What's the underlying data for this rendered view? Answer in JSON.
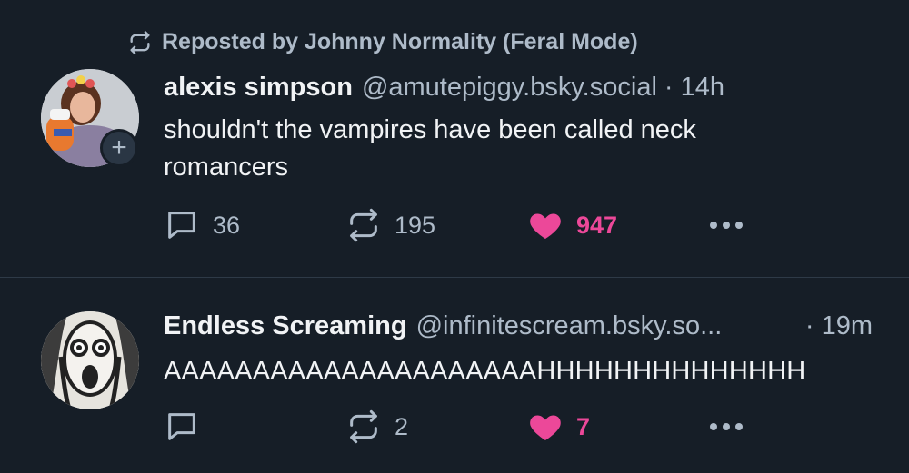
{
  "posts": [
    {
      "repost_label": "Reposted by Johnny Normality (Feral Mode)",
      "author": {
        "display_name": "alexis simpson",
        "handle": "@amutepiggy.bsky.social"
      },
      "separator": "·",
      "time": "14h",
      "text": "shouldn't the vampires have been called neck romancers",
      "stats": {
        "replies": "36",
        "reposts": "195",
        "likes": "947"
      },
      "liked": true
    },
    {
      "author": {
        "display_name": "Endless Screaming",
        "handle": "@infinitescream.bsky.so..."
      },
      "separator": "·",
      "time": "19m",
      "text": "AAAAAAAAAAAAAAAAAAAAAHHHHHHHHHHHHHH",
      "stats": {
        "replies": "",
        "reposts": "2",
        "likes": "7"
      },
      "liked": true
    }
  ],
  "icons": {
    "repost": "repost-icon",
    "reply": "reply-bubble-icon",
    "like": "heart-icon",
    "more": "more-dots-icon",
    "follow": "plus-icon"
  },
  "colors": {
    "background": "#161e27",
    "muted": "#aebbc9",
    "like": "#ec4899",
    "text": "#f1f3f5"
  }
}
